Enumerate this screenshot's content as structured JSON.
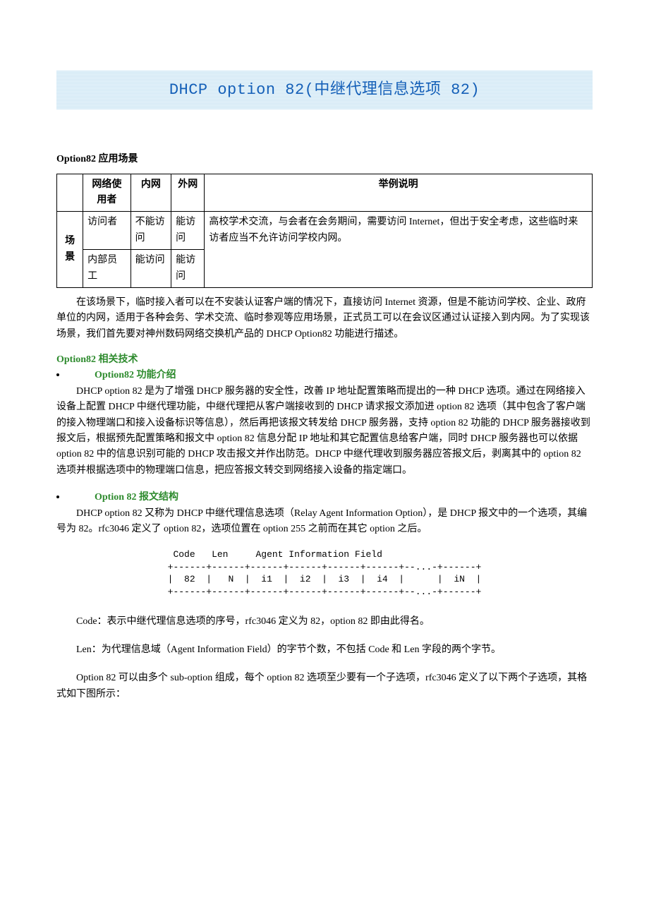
{
  "title": "DHCP option 82(中继代理信息选项 82)",
  "section1": {
    "heading": "Option82 应用场景",
    "table": {
      "headers": [
        "",
        "网络使用者",
        "内网",
        "外网",
        "举例说明"
      ],
      "rowhead": "场景",
      "rows": [
        [
          "访问者",
          "不能访问",
          "能访问"
        ],
        [
          "内部员工",
          "能访问",
          "能访问"
        ]
      ],
      "example": "高校学术交流，与会者在会务期间，需要访问 Internet，但出于安全考虑，这些临时来访者应当不允许访问学校内网。"
    },
    "para": "在该场景下，临时接入者可以在不安装认证客户端的情况下，直接访问 Internet 资源，但是不能访问学校、企业、政府单位的内网，适用于各种会务、学术交流、临时参观等应用场景，正式员工可以在会议区通过认证接入到内网。为了实现该场景，我们首先要对神州数码网络交换机产品的 DHCP Option82 功能进行描述。"
  },
  "section2": {
    "heading": "Option82 相关技术",
    "sub1": {
      "heading": "Option82 功能介绍",
      "para": "DHCP option 82 是为了增强 DHCP 服务器的安全性，改善 IP 地址配置策略而提出的一种 DHCP 选项。通过在网络接入设备上配置 DHCP 中继代理功能，中继代理把从客户端接收到的 DHCP 请求报文添加进 option 82 选项（其中包含了客户端的接入物理端口和接入设备标识等信息），然后再把该报文转发给 DHCP 服务器，支持 option 82 功能的 DHCP 服务器接收到报文后，根据预先配置策略和报文中 option 82 信息分配 IP 地址和其它配置信息给客户端，同时 DHCP 服务器也可以依据 option 82 中的信息识别可能的 DHCP 攻击报文并作出防范。DHCP 中继代理收到服务器应答报文后，剥离其中的 option 82 选项并根据选项中的物理端口信息，把应答报文转交到网络接入设备的指定端口。"
    },
    "sub2": {
      "heading": "Option 82 报文结构",
      "para1": "DHCP option 82 又称为 DHCP 中继代理信息选项（Relay Agent Information Option），是 DHCP 报文中的一个选项，其编号为 82。rfc3046 定义了 option 82，选项位置在 option 255 之前而在其它 option 之后。",
      "fig": " Code   Len     Agent Information Field\n+------+------+------+------+------+------+--...-+------+\n|  82  |   N  |  i1  |  i2  |  i3  |  i4  |      |  iN  |\n+------+------+------+------+------+------+--...-+------+",
      "para2": "Code：表示中继代理信息选项的序号，rfc3046 定义为 82，option 82 即由此得名。",
      "para3": "Len：为代理信息域（Agent Information Field）的字节个数，不包括 Code 和 Len 字段的两个字节。",
      "para4": "Option 82 可以由多个 sub-option 组成，每个 option 82 选项至少要有一个子选项，rfc3046 定义了以下两个子选项，其格式如下图所示："
    }
  }
}
